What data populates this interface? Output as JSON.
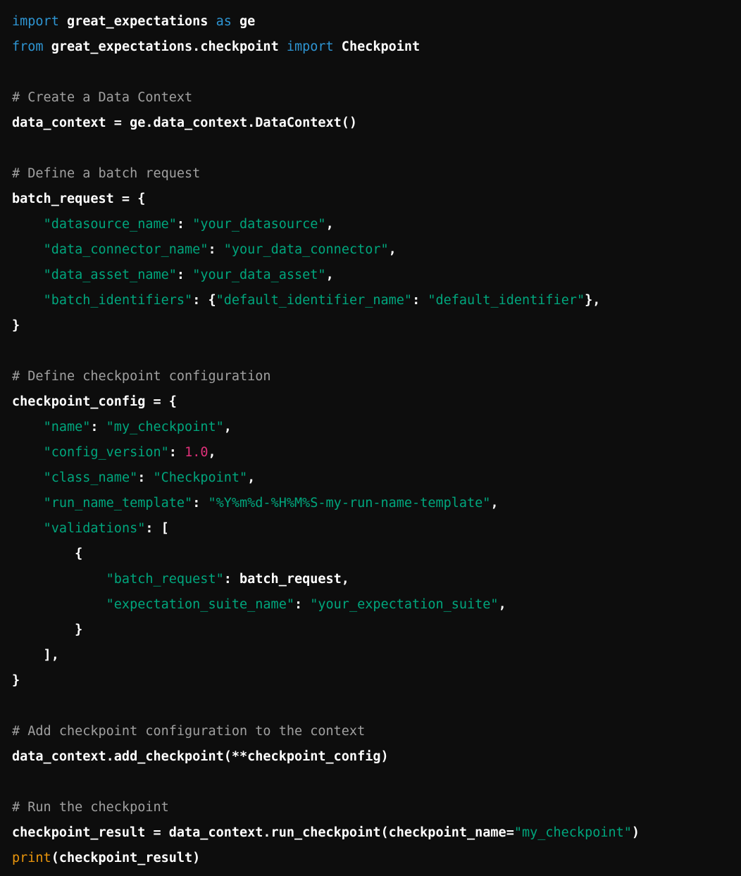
{
  "code": {
    "language": "python",
    "colors": {
      "background": "#0d0d0d",
      "keyword": "#2e95d3",
      "comment": "#a0a0a0",
      "string": "#00a67d",
      "number": "#df3079",
      "builtin": "#e9950c",
      "text": "#ffffff"
    },
    "lines": [
      [
        {
          "t": "kw",
          "v": "import"
        },
        {
          "t": "pl",
          "v": " great_expectations "
        },
        {
          "t": "kw",
          "v": "as"
        },
        {
          "t": "pl",
          "v": " ge"
        }
      ],
      [
        {
          "t": "kw",
          "v": "from"
        },
        {
          "t": "pl",
          "v": " great_expectations.checkpoint "
        },
        {
          "t": "kw",
          "v": "import"
        },
        {
          "t": "pl",
          "v": " Checkpoint"
        }
      ],
      [],
      [
        {
          "t": "cm",
          "v": "# Create a Data Context"
        }
      ],
      [
        {
          "t": "pl",
          "v": "data_context = ge.data_context.DataContext()"
        }
      ],
      [],
      [
        {
          "t": "cm",
          "v": "# Define a batch request"
        }
      ],
      [
        {
          "t": "pl",
          "v": "batch_request = {"
        }
      ],
      [
        {
          "t": "pl",
          "v": "    "
        },
        {
          "t": "str",
          "v": "\"datasource_name\""
        },
        {
          "t": "pl",
          "v": ": "
        },
        {
          "t": "str",
          "v": "\"your_datasource\""
        },
        {
          "t": "pl",
          "v": ","
        }
      ],
      [
        {
          "t": "pl",
          "v": "    "
        },
        {
          "t": "str",
          "v": "\"data_connector_name\""
        },
        {
          "t": "pl",
          "v": ": "
        },
        {
          "t": "str",
          "v": "\"your_data_connector\""
        },
        {
          "t": "pl",
          "v": ","
        }
      ],
      [
        {
          "t": "pl",
          "v": "    "
        },
        {
          "t": "str",
          "v": "\"data_asset_name\""
        },
        {
          "t": "pl",
          "v": ": "
        },
        {
          "t": "str",
          "v": "\"your_data_asset\""
        },
        {
          "t": "pl",
          "v": ","
        }
      ],
      [
        {
          "t": "pl",
          "v": "    "
        },
        {
          "t": "str",
          "v": "\"batch_identifiers\""
        },
        {
          "t": "pl",
          "v": ": {"
        },
        {
          "t": "str",
          "v": "\"default_identifier_name\""
        },
        {
          "t": "pl",
          "v": ": "
        },
        {
          "t": "str",
          "v": "\"default_identifier\""
        },
        {
          "t": "pl",
          "v": "},"
        }
      ],
      [
        {
          "t": "pl",
          "v": "}"
        }
      ],
      [],
      [
        {
          "t": "cm",
          "v": "# Define checkpoint configuration"
        }
      ],
      [
        {
          "t": "pl",
          "v": "checkpoint_config = {"
        }
      ],
      [
        {
          "t": "pl",
          "v": "    "
        },
        {
          "t": "str",
          "v": "\"name\""
        },
        {
          "t": "pl",
          "v": ": "
        },
        {
          "t": "str",
          "v": "\"my_checkpoint\""
        },
        {
          "t": "pl",
          "v": ","
        }
      ],
      [
        {
          "t": "pl",
          "v": "    "
        },
        {
          "t": "str",
          "v": "\"config_version\""
        },
        {
          "t": "pl",
          "v": ": "
        },
        {
          "t": "num",
          "v": "1.0"
        },
        {
          "t": "pl",
          "v": ","
        }
      ],
      [
        {
          "t": "pl",
          "v": "    "
        },
        {
          "t": "str",
          "v": "\"class_name\""
        },
        {
          "t": "pl",
          "v": ": "
        },
        {
          "t": "str",
          "v": "\"Checkpoint\""
        },
        {
          "t": "pl",
          "v": ","
        }
      ],
      [
        {
          "t": "pl",
          "v": "    "
        },
        {
          "t": "str",
          "v": "\"run_name_template\""
        },
        {
          "t": "pl",
          "v": ": "
        },
        {
          "t": "str",
          "v": "\"%Y%m%d-%H%M%S-my-run-name-template\""
        },
        {
          "t": "pl",
          "v": ","
        }
      ],
      [
        {
          "t": "pl",
          "v": "    "
        },
        {
          "t": "str",
          "v": "\"validations\""
        },
        {
          "t": "pl",
          "v": ": ["
        }
      ],
      [
        {
          "t": "pl",
          "v": "        {"
        }
      ],
      [
        {
          "t": "pl",
          "v": "            "
        },
        {
          "t": "str",
          "v": "\"batch_request\""
        },
        {
          "t": "pl",
          "v": ": batch_request,"
        }
      ],
      [
        {
          "t": "pl",
          "v": "            "
        },
        {
          "t": "str",
          "v": "\"expectation_suite_name\""
        },
        {
          "t": "pl",
          "v": ": "
        },
        {
          "t": "str",
          "v": "\"your_expectation_suite\""
        },
        {
          "t": "pl",
          "v": ","
        }
      ],
      [
        {
          "t": "pl",
          "v": "        }"
        }
      ],
      [
        {
          "t": "pl",
          "v": "    ],"
        }
      ],
      [
        {
          "t": "pl",
          "v": "}"
        }
      ],
      [],
      [
        {
          "t": "cm",
          "v": "# Add checkpoint configuration to the context"
        }
      ],
      [
        {
          "t": "pl",
          "v": "data_context.add_checkpoint(**checkpoint_config)"
        }
      ],
      [],
      [
        {
          "t": "cm",
          "v": "# Run the checkpoint"
        }
      ],
      [
        {
          "t": "pl",
          "v": "checkpoint_result = data_context.run_checkpoint(checkpoint_name="
        },
        {
          "t": "str",
          "v": "\"my_checkpoint\""
        },
        {
          "t": "pl",
          "v": ")"
        }
      ],
      [
        {
          "t": "bi",
          "v": "print"
        },
        {
          "t": "pl",
          "v": "(checkpoint_result)"
        }
      ]
    ]
  }
}
